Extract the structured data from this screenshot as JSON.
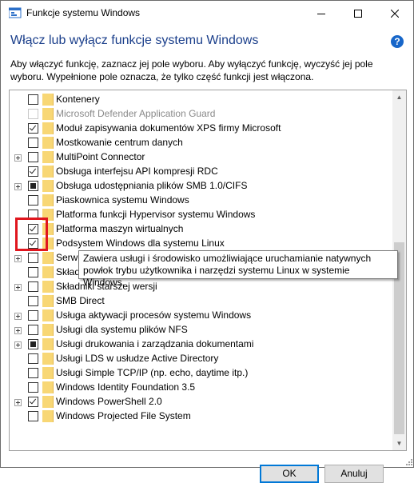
{
  "window": {
    "title": "Funkcje systemu Windows",
    "heading": "Włącz lub wyłącz funkcje systemu Windows",
    "help_glyph": "?",
    "description": "Aby włączyć funkcję, zaznacz jej pole wyboru. Aby wyłączyć funkcję, wyczyść jej pole wyboru. Wypełnione pole oznacza, że tylko część funkcji jest włączona."
  },
  "features": [
    {
      "label": "Kontenery",
      "state": "unchecked",
      "expandable": false,
      "disabled": false
    },
    {
      "label": "Microsoft Defender Application Guard",
      "state": "unchecked",
      "expandable": false,
      "disabled": true
    },
    {
      "label": "Moduł zapisywania dokumentów XPS firmy Microsoft",
      "state": "checked",
      "expandable": false,
      "disabled": false
    },
    {
      "label": "Mostkowanie centrum danych",
      "state": "unchecked",
      "expandable": false,
      "disabled": false
    },
    {
      "label": "MultiPoint Connector",
      "state": "unchecked",
      "expandable": true,
      "disabled": false
    },
    {
      "label": "Obsługa interfejsu API kompresji RDC",
      "state": "checked",
      "expandable": false,
      "disabled": false
    },
    {
      "label": "Obsługa udostępniania plików SMB 1.0/CIFS",
      "state": "partial",
      "expandable": true,
      "disabled": false
    },
    {
      "label": "Piaskownica systemu Windows",
      "state": "unchecked",
      "expandable": false,
      "disabled": false
    },
    {
      "label": "Platforma funkcji Hypervisor systemu Windows",
      "state": "unchecked",
      "expandable": false,
      "disabled": false
    },
    {
      "label": "Platforma maszyn wirtualnych",
      "state": "checked",
      "expandable": false,
      "disabled": false
    },
    {
      "label": "Podsystem Windows dla systemu Linux",
      "state": "checked",
      "expandable": false,
      "disabled": false
    },
    {
      "label": "Serwe",
      "state": "unchecked",
      "expandable": true,
      "disabled": false
    },
    {
      "label": "Składn",
      "state": "unchecked",
      "expandable": false,
      "disabled": false
    },
    {
      "label": "Składniki starszej wersji",
      "state": "unchecked",
      "expandable": true,
      "disabled": false
    },
    {
      "label": "SMB Direct",
      "state": "unchecked",
      "expandable": false,
      "disabled": false
    },
    {
      "label": "Usługa aktywacji procesów systemu Windows",
      "state": "unchecked",
      "expandable": true,
      "disabled": false
    },
    {
      "label": "Usługi dla systemu plików NFS",
      "state": "unchecked",
      "expandable": true,
      "disabled": false
    },
    {
      "label": "Usługi drukowania i zarządzania dokumentami",
      "state": "partial",
      "expandable": true,
      "disabled": false
    },
    {
      "label": "Usługi LDS w usłudze Active Directory",
      "state": "unchecked",
      "expandable": false,
      "disabled": false
    },
    {
      "label": "Usługi Simple TCP/IP (np. echo, daytime itp.)",
      "state": "unchecked",
      "expandable": false,
      "disabled": false
    },
    {
      "label": "Windows Identity Foundation 3.5",
      "state": "unchecked",
      "expandable": false,
      "disabled": false
    },
    {
      "label": "Windows PowerShell 2.0",
      "state": "checked",
      "expandable": true,
      "disabled": false
    },
    {
      "label": "Windows Projected File System",
      "state": "unchecked",
      "expandable": false,
      "disabled": false
    }
  ],
  "tooltip": {
    "line1": "Zawiera usługi i środowisko umożliwiające uruchamianie natywnych",
    "line2": "powłok trybu użytkownika i narzędzi systemu Linux w systemie Windows."
  },
  "buttons": {
    "ok": "OK",
    "cancel": "Anuluj"
  }
}
